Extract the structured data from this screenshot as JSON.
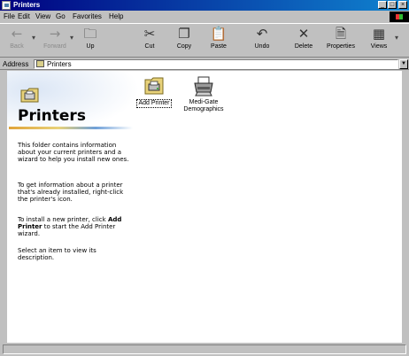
{
  "window": {
    "title": "Printers",
    "controls": {
      "minimize": "_",
      "maximize": "□",
      "close": "×"
    }
  },
  "menu": [
    "File",
    "Edit",
    "View",
    "Go",
    "Favorites",
    "Help"
  ],
  "toolbar": {
    "buttons": [
      {
        "label": "Back",
        "icon": "back-arrow-icon",
        "glyph": "←",
        "enabled": false
      },
      {
        "label": "Forward",
        "icon": "forward-arrow-icon",
        "glyph": "→",
        "enabled": false
      },
      {
        "label": "Up",
        "icon": "up-folder-icon",
        "glyph": "🗀",
        "enabled": true
      },
      {
        "label": "Cut",
        "icon": "scissors-icon",
        "glyph": "✂",
        "enabled": true
      },
      {
        "label": "Copy",
        "icon": "copy-icon",
        "glyph": "❐",
        "enabled": true
      },
      {
        "label": "Paste",
        "icon": "paste-icon",
        "glyph": "📋",
        "enabled": true
      },
      {
        "label": "Undo",
        "icon": "undo-icon",
        "glyph": "↶",
        "enabled": true
      },
      {
        "label": "Delete",
        "icon": "delete-x-icon",
        "glyph": "✕",
        "enabled": true
      },
      {
        "label": "Properties",
        "icon": "properties-icon",
        "glyph": "🗎",
        "enabled": true
      },
      {
        "label": "Views",
        "icon": "views-icon",
        "glyph": "▦",
        "enabled": true
      }
    ]
  },
  "address": {
    "label": "Address",
    "value": "Printers"
  },
  "folder": {
    "title": "Printers",
    "description": [
      "This folder contains information about your current printers and a wizard to help you install new ones.",
      "To get information about a printer that's already installed, right-click the printer's icon.",
      "Select an item to view its description."
    ],
    "install_prefix": "To install a new printer, click",
    "install_bold": "Add Printer",
    "install_suffix": "to start the Add Printer wizard."
  },
  "items": [
    {
      "label": "Add Printer",
      "icon": "add-printer-icon"
    },
    {
      "label": "Medi-Gate Demographics",
      "icon": "printer-icon"
    }
  ],
  "colors": {
    "titlebar_start": "#000080",
    "titlebar_end": "#1084d0",
    "chrome": "#c0c0c0"
  }
}
